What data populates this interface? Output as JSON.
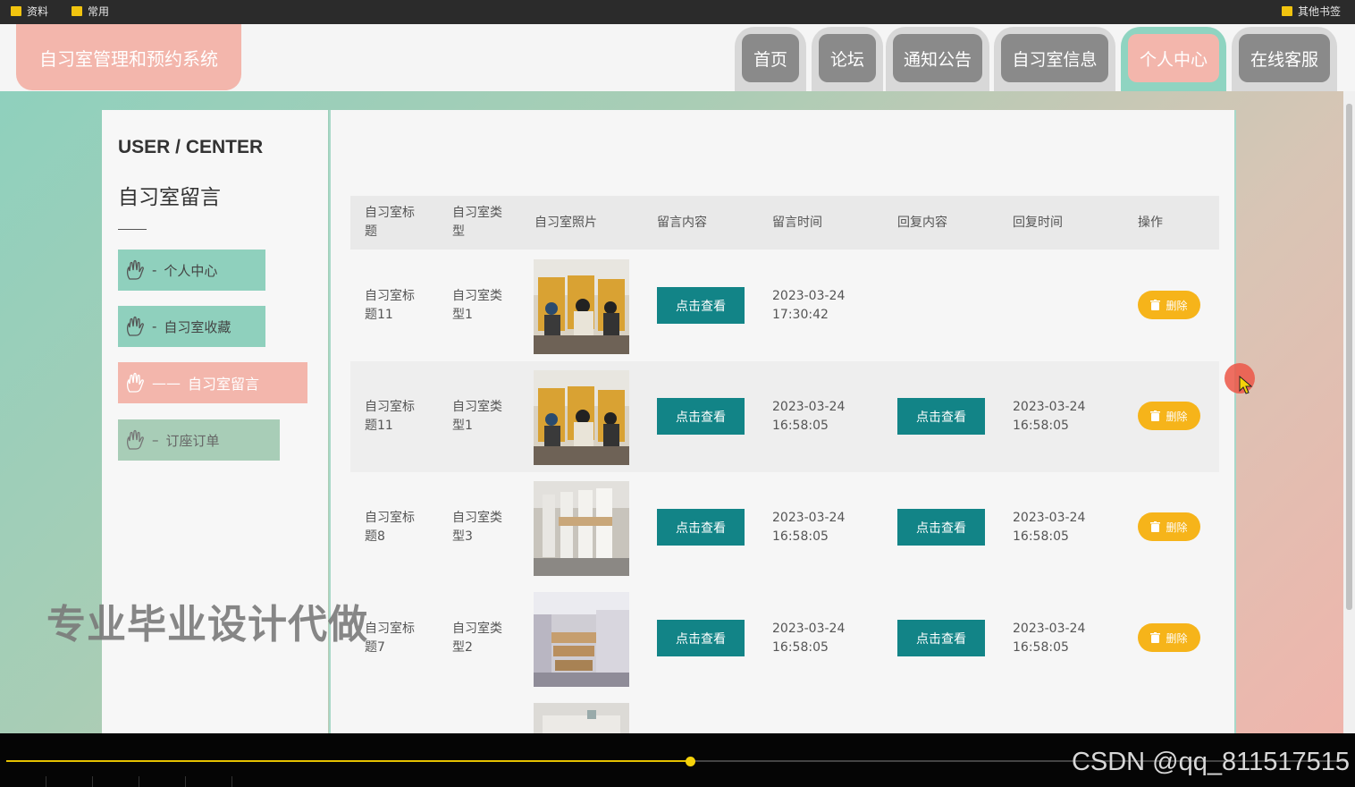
{
  "bookmarks": {
    "left": [
      "资料",
      "常用"
    ],
    "right": "其他书签"
  },
  "header": {
    "logo_text": "自习室管理和预约系统",
    "nav": [
      "首页",
      "论坛",
      "通知公告",
      "自习室信息",
      "个人中心",
      "在线客服"
    ],
    "active_nav": "个人中心"
  },
  "sidebar": {
    "title": "USER / CENTER",
    "subtitle": "自习室留言",
    "items": [
      {
        "label": "个人中心",
        "dash": "-"
      },
      {
        "label": "自习室收藏",
        "dash": "-"
      },
      {
        "label": "自习室留言",
        "dash": "——",
        "active": true
      },
      {
        "label": "订座订单",
        "dash": "–"
      }
    ]
  },
  "table": {
    "headers": [
      "自习室标题",
      "自习室类型",
      "自习室照片",
      "留言内容",
      "留言时间",
      "回复内容",
      "回复时间",
      "操作"
    ],
    "rows": [
      {
        "title": "自习室标题11",
        "type": "自习室类型1",
        "msg_btn": "点击查看",
        "msg_time": "2023-03-24 17:30:42",
        "reply_btn": "",
        "reply_time": "",
        "delete": "删除"
      },
      {
        "title": "自习室标题11",
        "type": "自习室类型1",
        "msg_btn": "点击查看",
        "msg_time": "2023-03-24 16:58:05",
        "reply_btn": "点击查看",
        "reply_time": "2023-03-24 16:58:05",
        "delete": "删除"
      },
      {
        "title": "自习室标题8",
        "type": "自习室类型3",
        "msg_btn": "点击查看",
        "msg_time": "2023-03-24 16:58:05",
        "reply_btn": "点击查看",
        "reply_time": "2023-03-24 16:58:05",
        "delete": "删除"
      },
      {
        "title": "自习室标题7",
        "type": "自习室类型2",
        "msg_btn": "点击查看",
        "msg_time": "2023-03-24 16:58:05",
        "reply_btn": "点击查看",
        "reply_time": "2023-03-24 16:58:05",
        "delete": "删除"
      }
    ]
  },
  "overlay_text": "专业毕业设计代做",
  "watermark": "CSDN @qq_811517515",
  "player": {
    "progress": 0.51
  },
  "colors": {
    "teal_button": "#128487",
    "pink_accent": "#f3b6ac",
    "delete_button": "#f6b41a",
    "progress": "#e5c100"
  }
}
